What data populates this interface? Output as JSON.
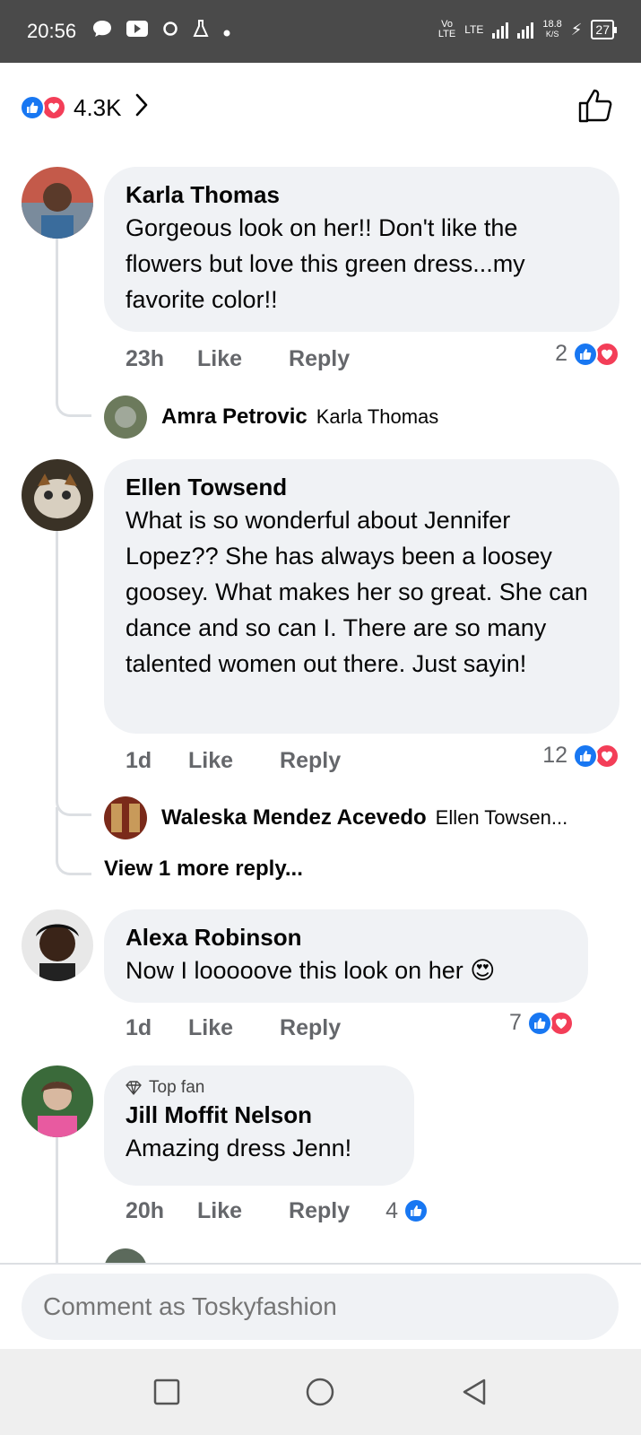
{
  "status_bar": {
    "time": "20:56",
    "network_label": "LTE",
    "speed": "18.8",
    "speed_unit": "K/S",
    "battery": "27"
  },
  "header": {
    "reaction_count": "4.3K"
  },
  "comments": [
    {
      "author": "Karla Thomas",
      "text": "Gorgeous look on her!! Don't like the flowers but love this green dress...my favorite color!!",
      "time": "23h",
      "like_label": "Like",
      "reply_label": "Reply",
      "reaction_count": "2",
      "reply_preview": {
        "author": "Amra Petrovic",
        "text": "Karla Thomas"
      }
    },
    {
      "author": "Ellen Towsend",
      "text": "What is so wonderful about Jennifer Lopez?? She has always been a loosey goosey. What makes her so great. She can dance and so can I. There are so many talented women out there. Just sayin!",
      "time": "1d",
      "like_label": "Like",
      "reply_label": "Reply",
      "reaction_count": "12",
      "reply_preview": {
        "author": "Waleska Mendez Acevedo",
        "text": "Ellen Towsen..."
      },
      "view_more": "View 1 more reply..."
    },
    {
      "author": "Alexa Robinson",
      "text": "Now I looooove this look on her",
      "emoji": "😍",
      "time": "1d",
      "like_label": "Like",
      "reply_label": "Reply",
      "reaction_count": "7"
    },
    {
      "badge": "Top fan",
      "author": "Jill Moffit Nelson",
      "text": "Amazing dress Jenn!",
      "time": "20h",
      "like_label": "Like",
      "reply_label": "Reply",
      "reaction_count": "4"
    }
  ],
  "composer": {
    "placeholder": "Comment as Toskyfashion"
  },
  "colors": {
    "like_blue": "#1877f2",
    "love_red": "#f33e58",
    "bubble_bg": "#f0f2f5",
    "meta_gray": "#65676b"
  }
}
